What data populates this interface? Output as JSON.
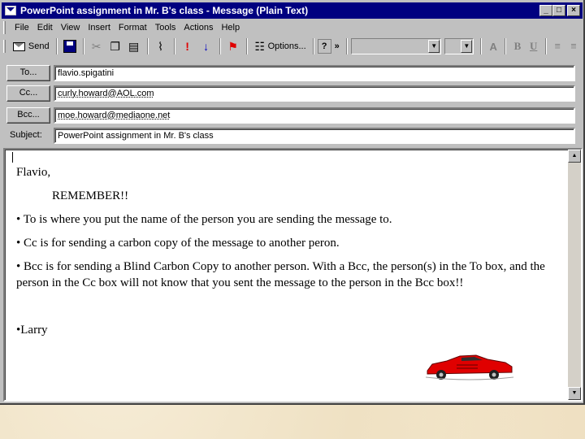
{
  "window": {
    "title": "PowerPoint assignment in Mr. B's class - Message (Plain Text)",
    "minimize": "_",
    "maximize": "□",
    "close": "×"
  },
  "menu": [
    {
      "label": "File"
    },
    {
      "label": "Edit"
    },
    {
      "label": "View"
    },
    {
      "label": "Insert"
    },
    {
      "label": "Format"
    },
    {
      "label": "Tools"
    },
    {
      "label": "Actions"
    },
    {
      "label": "Help"
    }
  ],
  "toolbar": {
    "send_label": "Send",
    "options_label": "Options...",
    "help_glyph": "?",
    "more_glyph": "»",
    "bold_label": "B",
    "underline_label": "U"
  },
  "header": {
    "to_button": "To...",
    "cc_button": "Cc...",
    "bcc_button": "Bcc...",
    "subject_label": "Subject:",
    "to_value": "flavio.spigatini",
    "cc_value": "curly.howard@AOL.com",
    "bcc_value": "moe.howard@mediaone.net",
    "subject_value": "PowerPoint assignment in Mr. B's class"
  },
  "message": {
    "greeting": "Flavio,",
    "remember": "REMEMBER!!",
    "line_to": "• To is where you put the name of the person you are sending the message to.",
    "line_cc": "• Cc is for sending  a carbon copy of the message to another peron.",
    "line_bcc": "• Bcc is for sending a Blind Carbon Copy to another person.  With a Bcc, the person(s) in the To box, and the person in the Cc box will not know that you sent the message to the person in the Bcc box!!",
    "signature": "•Larry"
  },
  "colors": {
    "titlebar": "#000080",
    "chrome": "#c0c0c0",
    "car_red": "#e00000"
  }
}
